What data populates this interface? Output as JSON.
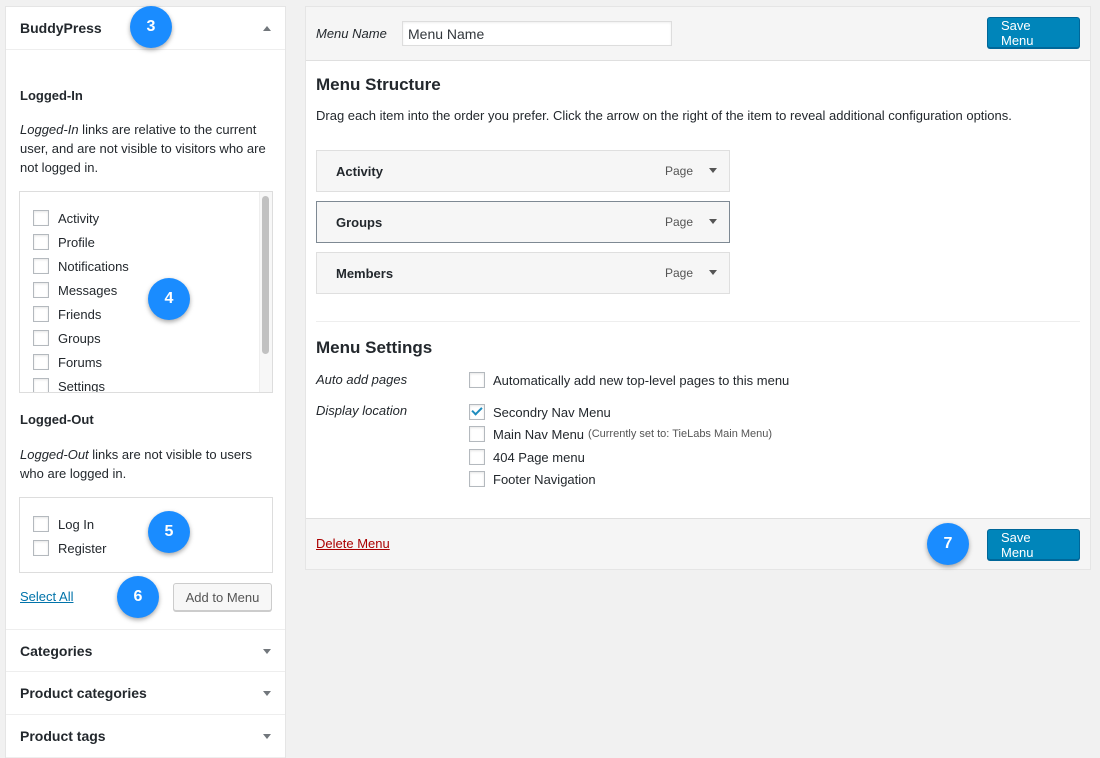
{
  "left_panel": {
    "buddypress": {
      "title": "BuddyPress",
      "logged_in": {
        "heading": "Logged-In",
        "desc_em": "Logged-In",
        "desc_rest": " links are relative to the current user, and are not visible to visitors who are not logged in.",
        "items": [
          "Activity",
          "Profile",
          "Notifications",
          "Messages",
          "Friends",
          "Groups",
          "Forums",
          "Settings"
        ]
      },
      "logged_out": {
        "heading": "Logged-Out",
        "desc_em": "Logged-Out",
        "desc_rest": " links are not visible to users who are logged in.",
        "items": [
          "Log In",
          "Register"
        ]
      },
      "select_all": "Select All",
      "add_to_menu": "Add to Menu"
    },
    "sections": [
      "Categories",
      "Product categories",
      "Product tags"
    ]
  },
  "badges": [
    "3",
    "4",
    "5",
    "6",
    "7"
  ],
  "right_panel": {
    "menu_name_label": "Menu Name",
    "menu_name_value": "Menu Name",
    "save_menu": "Save Menu",
    "structure": {
      "title": "Menu Structure",
      "desc": "Drag each item into the order you prefer. Click the arrow on the right of the item to reveal additional configuration options.",
      "items": [
        {
          "title": "Activity",
          "type": "Page"
        },
        {
          "title": "Groups",
          "type": "Page"
        },
        {
          "title": "Members",
          "type": "Page"
        }
      ]
    },
    "settings": {
      "title": "Menu Settings",
      "auto_add_label": "Auto add pages",
      "auto_add_option": "Automatically add new top-level pages to this menu",
      "display_location_label": "Display location",
      "locations": [
        {
          "label": "Secondry Nav Menu",
          "note": "",
          "checked": true
        },
        {
          "label": "Main Nav Menu",
          "note": "(Currently set to: TieLabs Main Menu)",
          "checked": false
        },
        {
          "label": "404 Page menu",
          "note": "",
          "checked": false
        },
        {
          "label": "Footer Navigation",
          "note": "",
          "checked": false
        }
      ]
    },
    "delete_menu": "Delete Menu"
  },
  "colors": {
    "primary": "#0085ba",
    "badge": "#1a8cff",
    "delete": "#aa0000",
    "link": "#0073aa"
  }
}
